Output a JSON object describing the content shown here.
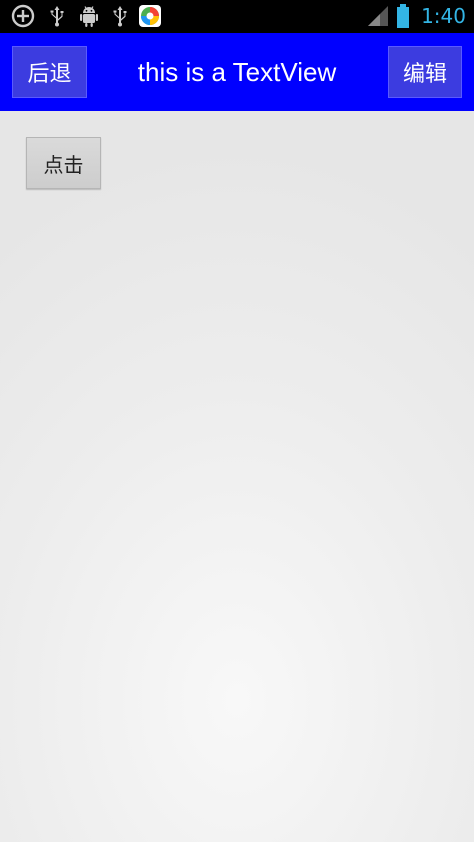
{
  "status_bar": {
    "icons": [
      "add-circle-icon",
      "usb-icon",
      "android-debug-icon",
      "usb-icon",
      "app-store-icon",
      "signal-icon",
      "battery-icon"
    ],
    "time": "1:40",
    "time_color": "#33b5e5"
  },
  "title_bar": {
    "background": "#0000ff",
    "back_label": "后退",
    "title": "this is a TextView",
    "edit_label": "编辑"
  },
  "content": {
    "click_label": "点击"
  }
}
